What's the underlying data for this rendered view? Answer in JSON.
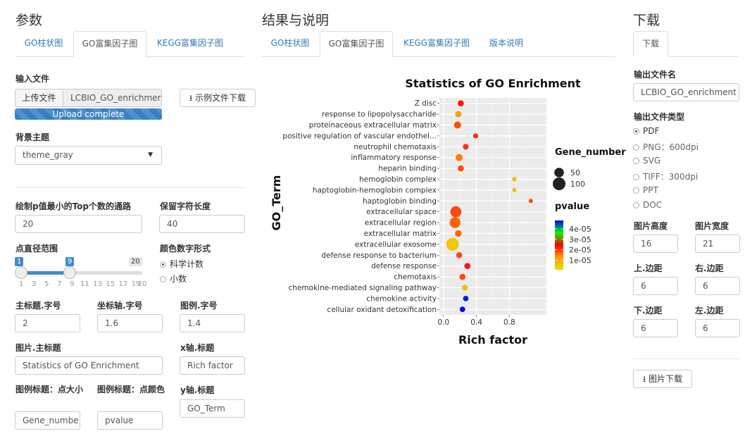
{
  "params": {
    "title": "参数",
    "tabs": [
      "GO柱状图",
      "GO富集因子图",
      "KEGG富集因子图"
    ],
    "input_file_label": "输入文件",
    "upload_button": "上传文件",
    "file_name": "LCBIO_GO_enrichmer",
    "upload_status": "Upload complete",
    "sample_download": "示例文件下载",
    "theme_label": "背景主题",
    "theme_value": "theme_gray",
    "top_n_label": "绘制p值最小的Top个数的通路",
    "top_n_value": "20",
    "keep_len_label": "保留字符长度",
    "keep_len_value": "40",
    "point_range_label": "点直径范围",
    "slider": {
      "min": 1,
      "max": 20,
      "low": 1,
      "high": 9,
      "min_label": "1",
      "max_label": "20",
      "low_label": "1",
      "high_label": "9",
      "ticks": [
        "1",
        "3",
        "5",
        "7",
        "9",
        "11",
        "13",
        "15",
        "17",
        "19",
        "20"
      ]
    },
    "num_format_label": "颜色数字形式",
    "num_format_options": [
      "科学计数",
      "小数"
    ],
    "main_title_size_label": "主标题.字号",
    "main_title_size_value": "2",
    "axis_size_label": "坐标轴.字号",
    "axis_size_value": "1.6",
    "legend_size_label": "图例.字号",
    "legend_size_value": "1.4",
    "main_title_label": "图片.主标题",
    "main_title_value": "Statistics of GO Enrichment",
    "xaxis_title_label": "x轴.标题",
    "xaxis_title_value": "Rich factor",
    "legend_size_title_label": "图例标题：点大小",
    "legend_size_title_value": "Gene_numbe",
    "legend_color_title_label": "图例标题：点颜色",
    "legend_color_title_value": "pvalue",
    "yaxis_title_label": "y轴.标题",
    "yaxis_title_value": "GO_Term"
  },
  "results": {
    "title": "结果与说明",
    "tabs": [
      "GO柱状图",
      "GO富集因子图",
      "KEGG富集因子图",
      "版本说明"
    ]
  },
  "download": {
    "title": "下载",
    "tab": "下载",
    "file_name_label": "输出文件名",
    "file_name_value": "LCBIO_GO_enrichment",
    "file_type_label": "输出文件类型",
    "file_types": [
      "PDF",
      "PNG：600dpi",
      "SVG",
      "TIFF：300dpi",
      "PPT",
      "DOC"
    ],
    "height_label": "图片高度",
    "height_value": "16",
    "width_label": "图片宽度",
    "width_value": "21",
    "top_margin_label": "上.边距",
    "top_margin_value": "6",
    "right_margin_label": "右.边距",
    "right_margin_value": "6",
    "bottom_margin_label": "下.边距",
    "bottom_margin_value": "6",
    "left_margin_label": "左.边距",
    "left_margin_value": "6",
    "download_button": "图片下载"
  },
  "chart_data": {
    "type": "scatter",
    "title": "Statistics of GO Enrichment",
    "xlabel": "Rich factor",
    "ylabel": "GO_Term",
    "xlim": [
      -0.05,
      1.25
    ],
    "xticks": [
      0.0,
      0.4,
      0.8
    ],
    "xtick_labels": [
      "0.0",
      "0.4",
      "0.8"
    ],
    "grid": true,
    "background": "#ebebeb",
    "categories": [
      "Z disc",
      "response to lipopolysaccharide",
      "proteinaceous extracellular matrix",
      "positive regulation of vascular endothel...",
      "neutrophil chemotaxis",
      "inflammatory response",
      "heparin binding",
      "hemoglobin complex",
      "haptoglobin-hemoglobin complex",
      "haptoglobin binding",
      "extracellular space",
      "extracellular region",
      "extracellular matrix",
      "extracellular exosome",
      "defense response to bacterium",
      "defense response",
      "chemotaxis",
      "chemokine-mediated signaling pathway",
      "chemokine activity",
      "cellular oxidant detoxification"
    ],
    "x": [
      0.21,
      0.18,
      0.17,
      0.39,
      0.27,
      0.19,
      0.21,
      0.86,
      0.86,
      1.06,
      0.15,
      0.14,
      0.18,
      0.11,
      0.19,
      0.29,
      0.23,
      0.26,
      0.27,
      0.23
    ],
    "gene_number": [
      14,
      16,
      22,
      8,
      12,
      22,
      14,
      4,
      4,
      4,
      70,
      68,
      18,
      100,
      14,
      14,
      14,
      12,
      10,
      10
    ],
    "pvalue": [
      1.2e-05,
      6e-06,
      1e-05,
      1.1e-05,
      1.1e-05,
      8e-06,
      1e-05,
      4e-06,
      4e-06,
      1e-05,
      1e-05,
      9e-06,
      9e-06,
      3e-06,
      1e-05,
      1.2e-05,
      1e-05,
      4e-06,
      4.5e-05,
      4.8e-05
    ],
    "size_legend": {
      "title": "Gene_number",
      "labels": [
        "50",
        "100"
      ],
      "values": [
        50,
        100
      ]
    },
    "color_legend": {
      "title": "pvalue",
      "labels": [
        "4e-05",
        "3e-05",
        "2e-05",
        "1e-05"
      ],
      "values": [
        4e-05,
        3e-05,
        2e-05,
        1e-05
      ],
      "colors": [
        "#e8e000",
        "#ff9a00",
        "#ff0000",
        "#00ff00",
        "#0000ff"
      ]
    }
  }
}
